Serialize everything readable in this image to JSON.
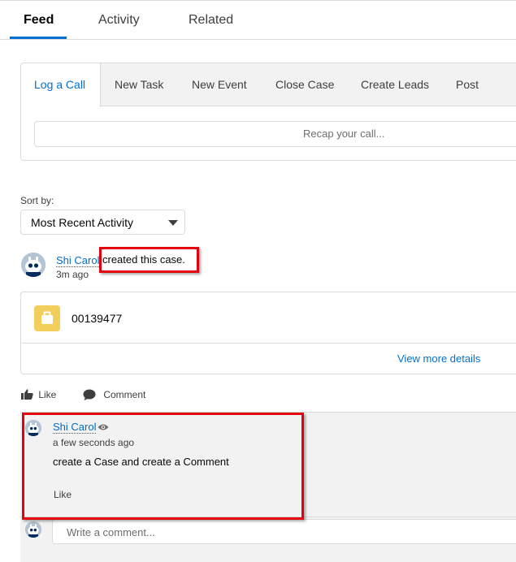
{
  "main_tabs": [
    {
      "label": "Feed",
      "active": true
    },
    {
      "label": "Activity",
      "active": false
    },
    {
      "label": "Related",
      "active": false
    }
  ],
  "publisher": {
    "tabs": [
      {
        "label": "Log a Call",
        "active": true
      },
      {
        "label": "New Task",
        "active": false
      },
      {
        "label": "New Event",
        "active": false
      },
      {
        "label": "Close Case",
        "active": false
      },
      {
        "label": "Create Leads",
        "active": false
      },
      {
        "label": "Post",
        "active": false
      }
    ],
    "input_placeholder": "Recap your call..."
  },
  "sort": {
    "label": "Sort by:",
    "selected": "Most Recent Activity"
  },
  "feed_item": {
    "author": "Shi Carol",
    "action": "created this case.",
    "time": "3m ago",
    "record_number": "00139477",
    "view_more": "View more details",
    "like_label": "Like",
    "comment_label": "Comment"
  },
  "comment": {
    "author": "Shi Carol",
    "time": "a few seconds ago",
    "body": "create a Case and create a Comment",
    "like_label": "Like",
    "write_placeholder": "Write a comment..."
  },
  "colors": {
    "link": "#0070d2",
    "highlight": "#e3000f",
    "case_icon": "#f2cf5b",
    "panel_bg": "#f3f2f2"
  },
  "icons": [
    "avatar-icon",
    "eye-icon",
    "like-icon",
    "comment-icon",
    "case-icon",
    "chevron-down-icon"
  ]
}
